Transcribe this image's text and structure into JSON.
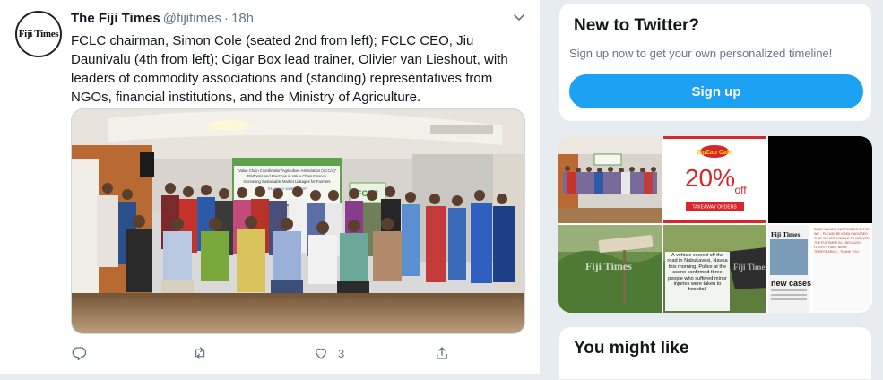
{
  "tweet": {
    "avatar_text": "Fiji Times",
    "name": "The Fiji Times",
    "handle": "@fijitimes",
    "separator": "·",
    "time": "18h",
    "text": "FCLC chairman, Simon Cole (seated 2nd from left); FCLC CEO, Jiu Daunivalu (4th from left); Cigar Box lead trainer, Olivier van Lieshout, with leaders of commodity associations and (standing) representatives from NGOs, financial institutions, and the Ministry of Agriculture.",
    "photo": {
      "banner_lines": [
        "\"Value Chain Coordination/Agriculture Association (VCC/A)\"",
        "Platforms and Practices in Value Chain Finance",
        "Increasing Sustainable Market Linkages for Farmers"
      ],
      "banner_sub": "TRAINING WORKSHOP",
      "sign": "FCLC"
    },
    "actions": {
      "reply_count": "",
      "retweet_count": "",
      "like_count": "3"
    }
  },
  "signup_card": {
    "title": "New to Twitter?",
    "subtitle": "Sign up now to get your own personalized timeline!",
    "button_label": "Sign up"
  },
  "media_grid": {
    "ad_brand": "ZipZap Cafe",
    "ad_percent": "20%",
    "ad_off": "off",
    "ad_sub": "TAKEAWAY ORDERS",
    "watermark": "Fiji Times",
    "caption": "A vehicle veered off the road in Nabukavesi, Navua this morning. Police at the scene confirmed three people who suffered minor injuries were taken to hospital.",
    "paper_masthead": "Fiji Times",
    "paper_headline": "new cases",
    "notice_text": "DEAR VALUED CUSTOMERS IN THE WE... PLEASE BE KINDLY ADVISED THAT WE ARE UNABLE TO DELIVER THE FIJI TIMES IN... BECAUSE FLIGHTS HAVE BEEN TEMPORARILY... THANK YOU"
  },
  "might_like": {
    "title": "You might like"
  },
  "colors": {
    "accent": "#1da1f2",
    "text": "#14171a",
    "muted": "#657786",
    "border": "#e6ecf0"
  }
}
